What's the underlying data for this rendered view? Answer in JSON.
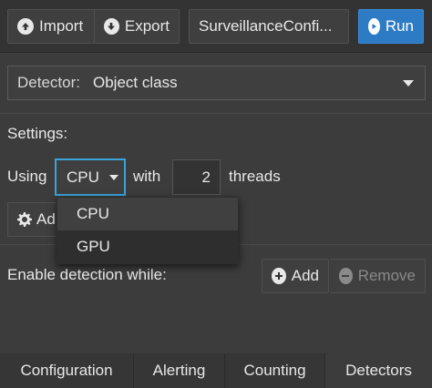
{
  "toolbar": {
    "import_label": "Import",
    "export_label": "Export",
    "config_name": "SurveillanceConfi...",
    "run_label": "Run"
  },
  "detector": {
    "label": "Detector:",
    "value": "Object class"
  },
  "settings": {
    "heading": "Settings:",
    "using_label": "Using",
    "device_value": "CPU",
    "with_label": "with",
    "threads_value": "2",
    "threads_label": "threads",
    "add_label": "Ad",
    "device_options": [
      "CPU",
      "GPU"
    ],
    "highlighted_option": "GPU"
  },
  "conditions": {
    "label": "Enable detection while:",
    "add_label": "Add",
    "remove_label": "Remove"
  },
  "tabs": [
    {
      "label": "Configuration"
    },
    {
      "label": "Alerting"
    },
    {
      "label": "Counting"
    },
    {
      "label": "Detectors"
    }
  ],
  "colors": {
    "accent": "#2d7bc4",
    "focus": "#3aa3d8"
  }
}
